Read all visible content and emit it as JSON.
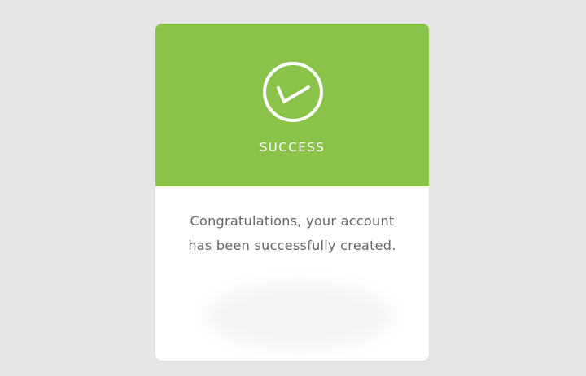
{
  "card": {
    "status_title": "SUCCESS",
    "message_line1": "Congratulations, your account",
    "message_line2": "has been successfully created."
  },
  "colors": {
    "header_accent": "#8bc34a",
    "page_background": "#e5e5e5",
    "card_background": "#ffffff",
    "message_text": "#666666"
  },
  "icons": {
    "status_icon": "check-circle-icon"
  }
}
